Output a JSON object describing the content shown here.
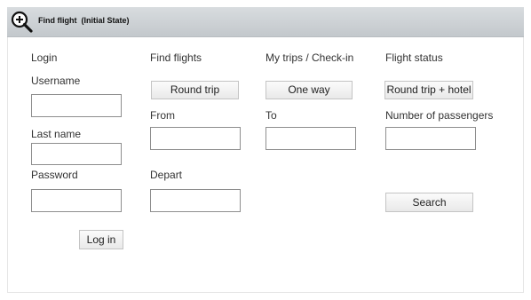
{
  "window": {
    "title": "Find flight",
    "subtitle": "(Initial State)",
    "zoom_icon": "zoom-in-icon"
  },
  "nav": {
    "login": "Login",
    "find_flights": "Find flights",
    "my_trips": "My trips / Check-in",
    "flight_status": "Flight status"
  },
  "login": {
    "username_label": "Username",
    "username_value": "",
    "lastname_label": "Last name",
    "lastname_value": "",
    "password_label": "Password",
    "password_value": "",
    "login_button": "Log in"
  },
  "search": {
    "round_trip_button": "Round trip",
    "one_way_button": "One way",
    "round_trip_hotel_button": "Round trip + hotel",
    "from_label": "From",
    "from_value": "",
    "to_label": "To",
    "to_value": "",
    "passengers_label": "Number of passengers",
    "passengers_value": "",
    "depart_label": "Depart",
    "depart_value": "",
    "search_button": "Search"
  }
}
